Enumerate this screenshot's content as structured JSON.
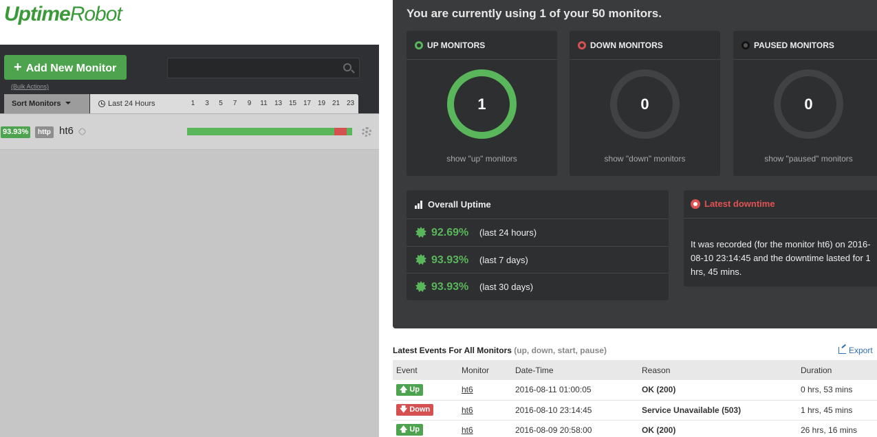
{
  "logo": {
    "part1": "Uptime",
    "part2": "Robot"
  },
  "toolbar": {
    "add_label": "Add New Monitor",
    "bulk_label": "(Bulk Actions)",
    "search_placeholder": "",
    "sort_label": "Sort Monitors",
    "time_label": "Last 24 Hours",
    "hours": [
      "1",
      "3",
      "5",
      "7",
      "9",
      "11",
      "13",
      "15",
      "17",
      "19",
      "21",
      "23"
    ]
  },
  "monitors": [
    {
      "uptime": "93.93%",
      "type": "http",
      "name": "ht6",
      "uptime_bar_down_fraction": 0.075
    }
  ],
  "usage": {
    "title": "You are currently using 1 of your 50 monitors."
  },
  "cards": [
    {
      "title": "UP MONITORS",
      "value": "1",
      "link": "show \"up\" monitors",
      "color": "#5ab65a"
    },
    {
      "title": "DOWN MONITORS",
      "value": "0",
      "link": "show \"down\" monitors",
      "color": "#d55050"
    },
    {
      "title": "PAUSED MONITORS",
      "value": "0",
      "link": "show \"paused\" monitors",
      "color": "#1a1a1a"
    }
  ],
  "overall": {
    "title": "Overall Uptime",
    "rows": [
      {
        "pct": "92.69%",
        "range": "(last 24 hours)"
      },
      {
        "pct": "93.93%",
        "range": "(last 7 days)"
      },
      {
        "pct": "93.93%",
        "range": "(last 30 days)"
      }
    ]
  },
  "downtime": {
    "title": "Latest downtime",
    "text": "It was recorded (for the monitor ht6) on 2016-08-10 23:14:45 and the downtime lasted for 1 hrs, 45 mins."
  },
  "events": {
    "title": "Latest Events For All Monitors",
    "subtitle": "(up, down, start, pause)",
    "export_label": "Export",
    "columns": [
      "Event",
      "Monitor",
      "Date-Time",
      "Reason",
      "Duration"
    ],
    "rows": [
      {
        "event": "Up",
        "type": "up",
        "monitor": "ht6",
        "datetime": "2016-08-11 01:00:05",
        "reason": "OK (200)",
        "duration": "0 hrs, 53 mins"
      },
      {
        "event": "Down",
        "type": "down",
        "monitor": "ht6",
        "datetime": "2016-08-10 23:14:45",
        "reason": "Service Unavailable (503)",
        "duration": "1 hrs, 45 mins"
      },
      {
        "event": "Up",
        "type": "up",
        "monitor": "ht6",
        "datetime": "2016-08-09 20:58:00",
        "reason": "OK (200)",
        "duration": "26 hrs, 16 mins"
      }
    ]
  }
}
